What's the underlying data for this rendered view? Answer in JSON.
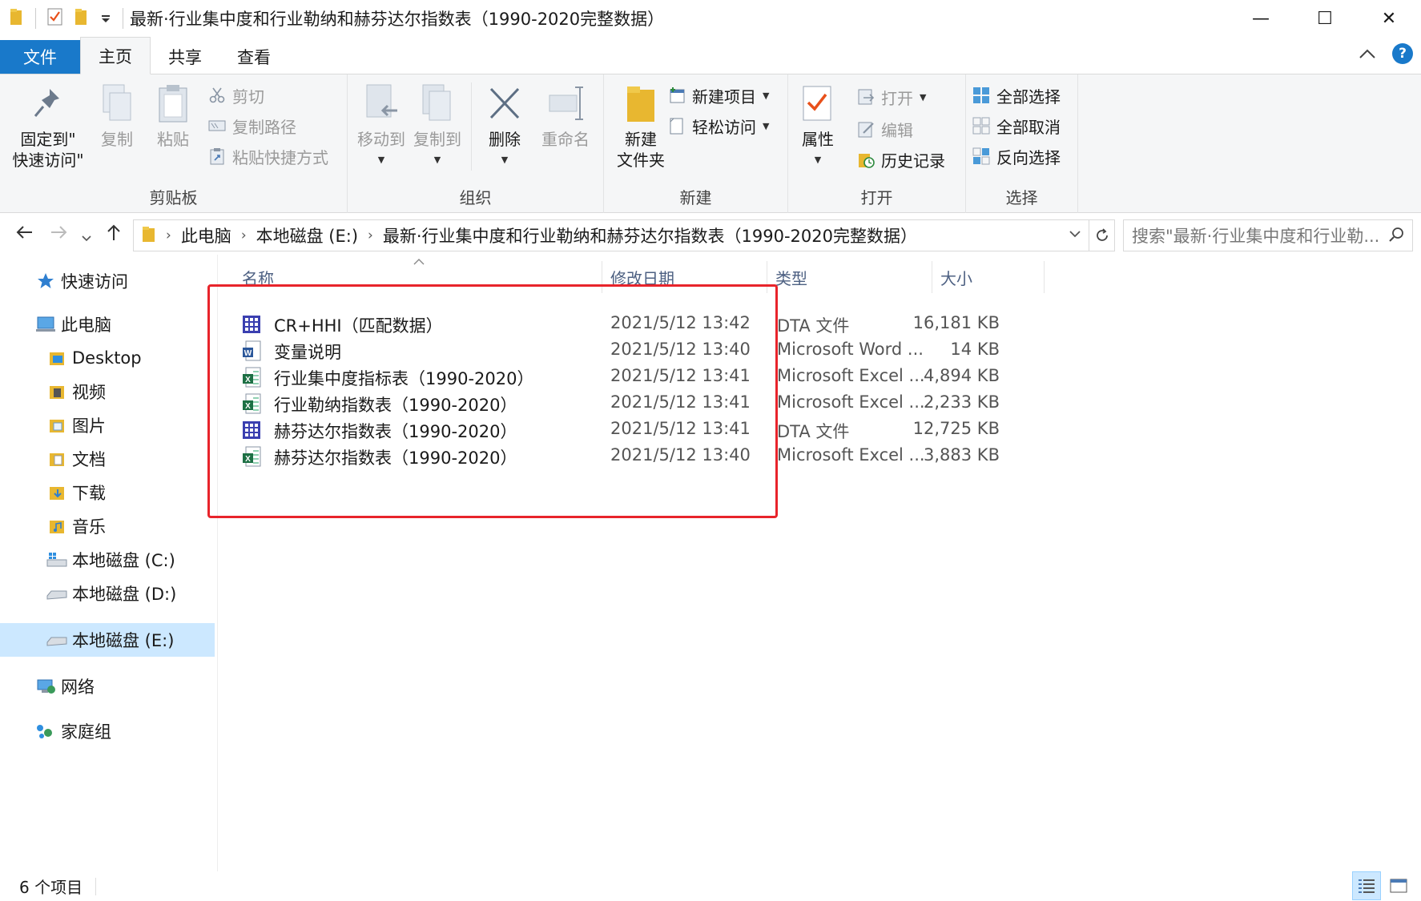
{
  "window": {
    "title": "最新·行业集中度和行业勒纳和赫芬达尔指数表（1990-2020完整数据）",
    "minimize": "—",
    "maximize": "☐",
    "close": "✕"
  },
  "tabs": {
    "file": "文件",
    "home": "主页",
    "share": "共享",
    "view": "查看"
  },
  "ribbon": {
    "clipboard": {
      "label": "剪贴板",
      "pin": "固定到\"\n快速访问\"",
      "copy": "复制",
      "paste": "粘贴",
      "cut": "剪切",
      "copy_path": "复制路径",
      "paste_shortcut": "粘贴快捷方式"
    },
    "organize": {
      "label": "组织",
      "move_to": "移动到",
      "copy_to": "复制到",
      "delete": "删除",
      "rename": "重命名"
    },
    "new": {
      "label": "新建",
      "new_folder": "新建\n文件夹",
      "new_item": "新建项目",
      "easy_access": "轻松访问"
    },
    "open": {
      "label": "打开",
      "properties": "属性",
      "open": "打开",
      "edit": "编辑",
      "history": "历史记录"
    },
    "select": {
      "label": "选择",
      "select_all": "全部选择",
      "select_none": "全部取消",
      "invert": "反向选择"
    }
  },
  "address": {
    "segments": [
      "此电脑",
      "本地磁盘 (E:)",
      "最新·行业集中度和行业勒纳和赫芬达尔指数表（1990-2020完整数据）"
    ],
    "search_placeholder": "搜索\"最新·行业集中度和行业勒..."
  },
  "nav": {
    "quick_access": "快速访问",
    "this_pc": "此电脑",
    "desktop": "Desktop",
    "videos": "视频",
    "pictures": "图片",
    "documents": "文档",
    "downloads": "下载",
    "music": "音乐",
    "drive_c": "本地磁盘 (C:)",
    "drive_d": "本地磁盘 (D:)",
    "drive_e": "本地磁盘 (E:)",
    "network": "网络",
    "homegroup": "家庭组"
  },
  "columns": {
    "name": "名称",
    "date": "修改日期",
    "type": "类型",
    "size": "大小"
  },
  "files": [
    {
      "name": "CR+HHI（匹配数据）",
      "date": "2021/5/12 13:42",
      "type": "DTA 文件",
      "size": "16,181 KB",
      "icon": "dta-icon"
    },
    {
      "name": "变量说明",
      "date": "2021/5/12 13:40",
      "type": "Microsoft Word ...",
      "size": "14 KB",
      "icon": "word-icon"
    },
    {
      "name": "行业集中度指标表（1990-2020）",
      "date": "2021/5/12 13:41",
      "type": "Microsoft Excel ...",
      "size": "4,894 KB",
      "icon": "excel-icon"
    },
    {
      "name": "行业勒纳指数表（1990-2020）",
      "date": "2021/5/12 13:41",
      "type": "Microsoft Excel ...",
      "size": "2,233 KB",
      "icon": "excel-icon"
    },
    {
      "name": "赫芬达尔指数表（1990-2020）",
      "date": "2021/5/12 13:41",
      "type": "DTA 文件",
      "size": "12,725 KB",
      "icon": "dta-icon"
    },
    {
      "name": "赫芬达尔指数表（1990-2020）",
      "date": "2021/5/12 13:40",
      "type": "Microsoft Excel ...",
      "size": "3,883 KB",
      "icon": "excel-icon"
    }
  ],
  "status": {
    "count": "6 个项目"
  },
  "colors": {
    "accent": "#1979ca",
    "highlight": "#e8242b",
    "selection": "#cce8ff"
  }
}
